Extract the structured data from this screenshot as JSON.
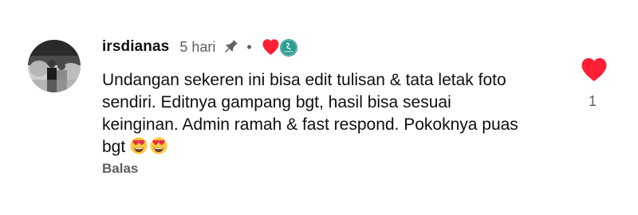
{
  "comment": {
    "author": "irsdianas",
    "time": "5 hari",
    "separator": "•",
    "text_lines": [
      "Undangan sekeren ini bisa edit tulisan & tata letak foto",
      "sendiri. Editnya gampang bgt, hasil bisa sesuai",
      "keinginan. Admin ramah & fast respond. Pokoknya puas",
      "bgt"
    ],
    "emojis": [
      "heart-eyes-emoji",
      "heart-eyes-emoji"
    ],
    "reply_label": "Balas",
    "like_count": "1"
  },
  "colors": {
    "text_primary": "#0f0f0f",
    "text_secondary": "#606060",
    "heart_red": "#ff1f35",
    "channel_teal": "#2c9c8e",
    "emoji_face": "#ffc83d",
    "emoji_heart": "#e62e4a"
  },
  "icons": {
    "pin": "pin-icon",
    "creator_heart": "creator-heart-icon",
    "like": "like-heart-icon"
  }
}
